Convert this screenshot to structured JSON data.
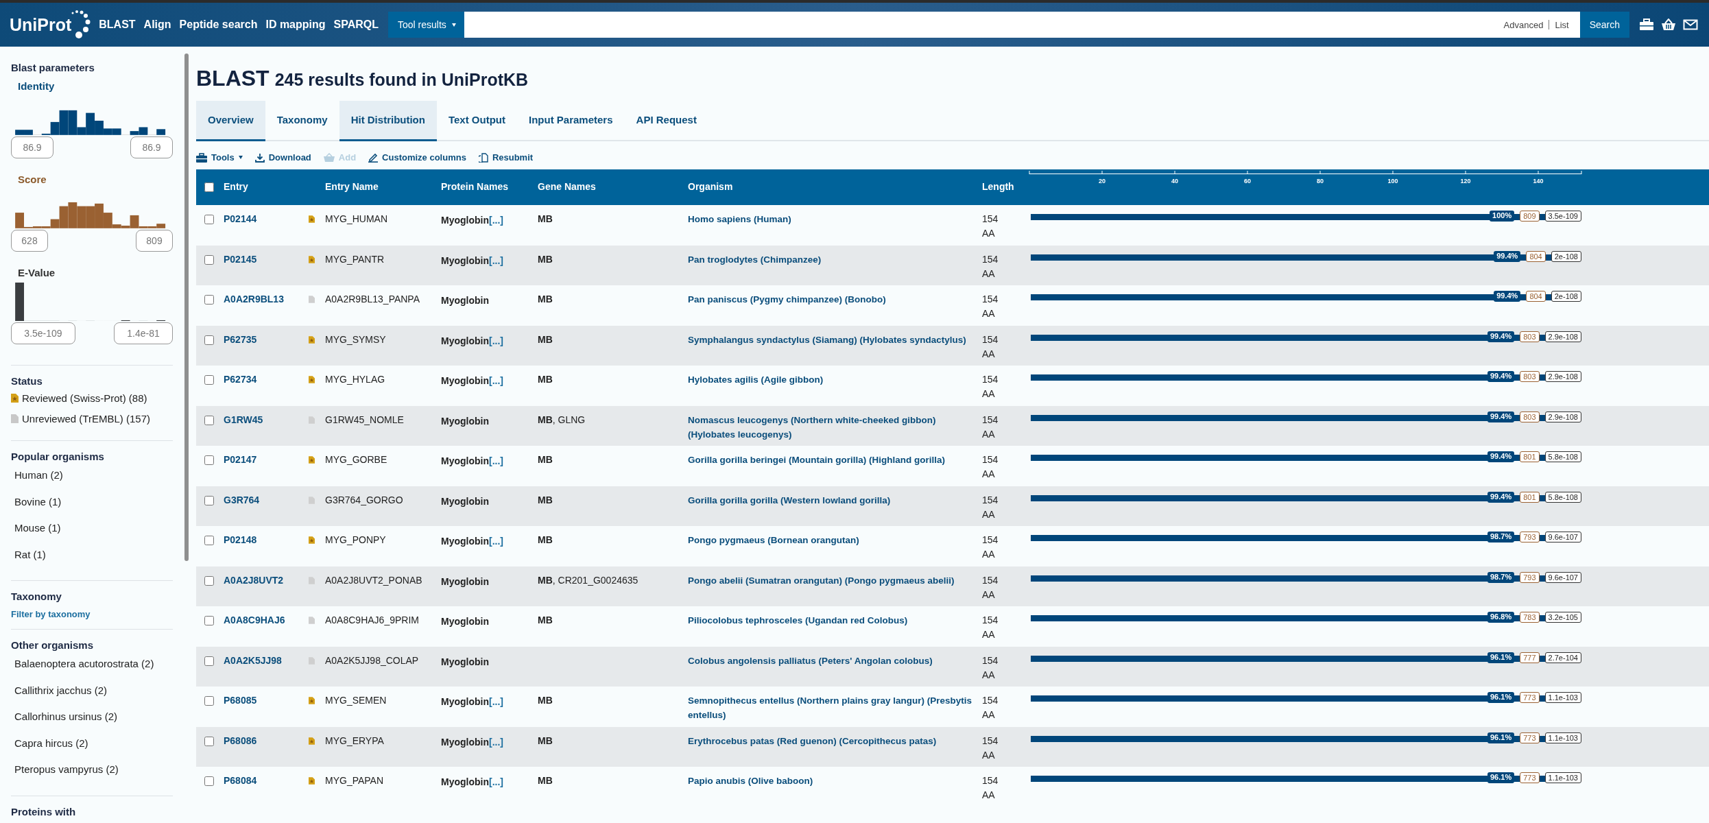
{
  "header": {
    "logo": "UniProt",
    "nav": [
      "BLAST",
      "Align",
      "Peptide search",
      "ID mapping",
      "SPARQL"
    ],
    "tool_menu": "Tool results",
    "search": {
      "links": [
        "Advanced",
        "List"
      ],
      "button": "Search"
    }
  },
  "sidebar": {
    "title": "Blast parameters",
    "ranges": [
      {
        "kind": "identity",
        "label": "Identity",
        "min": "86.9",
        "max": "86.9"
      },
      {
        "kind": "score",
        "label": "Score",
        "min": "628",
        "max": "809"
      },
      {
        "kind": "evalue",
        "label": "E-Value",
        "min": "3.5e-109",
        "max": "1.4e-81"
      }
    ],
    "status": {
      "title": "Status",
      "items": [
        {
          "label": "Reviewed (Swiss-Prot) (88)",
          "reviewed": true
        },
        {
          "label": "Unreviewed (TrEMBL) (157)",
          "reviewed": false
        }
      ]
    },
    "popular": {
      "title": "Popular organisms",
      "items": [
        "Human (2)",
        "Bovine (1)",
        "Mouse (1)",
        "Rat (1)"
      ]
    },
    "taxonomy": {
      "title": "Taxonomy",
      "link": "Filter by taxonomy"
    },
    "other": {
      "title": "Other organisms",
      "items": [
        "Balaenoptera acutorostrata (2)",
        "Callithrix jacchus (2)",
        "Callorhinus ursinus (2)",
        "Capra hircus (2)",
        "Pteropus vampyrus (2)"
      ]
    },
    "next_section": "Proteins with"
  },
  "main": {
    "title": "BLAST",
    "subtitle": "245 results found in UniProtKB",
    "tabs": [
      {
        "label": "Overview",
        "selected": true
      },
      {
        "label": "Taxonomy",
        "selected": false
      },
      {
        "label": "Hit Distribution",
        "selected": true
      },
      {
        "label": "Text Output",
        "selected": false
      },
      {
        "label": "Input Parameters",
        "selected": false
      },
      {
        "label": "API Request",
        "selected": false
      }
    ],
    "toolbar": [
      {
        "kind": "tools",
        "label": "Tools",
        "disabled": false
      },
      {
        "kind": "download",
        "label": "Download",
        "disabled": false
      },
      {
        "kind": "add",
        "label": "Add",
        "disabled": true
      },
      {
        "kind": "customize",
        "label": "Customize columns",
        "disabled": false
      },
      {
        "kind": "resubmit",
        "label": "Resubmit",
        "disabled": false
      }
    ]
  },
  "table": {
    "columns": [
      "Entry",
      "Entry Name",
      "Protein Names",
      "Gene Names",
      "Organism",
      "Length"
    ],
    "select_all_checked": false,
    "axis_ticks": [
      "20",
      "40",
      "60",
      "80",
      "100",
      "120",
      "140"
    ],
    "rows": [
      {
        "entry": "P02144",
        "reviewed": true,
        "entry_name": "MYG_HUMAN",
        "protein": "Myoglobin",
        "more": "[...]",
        "genes": "MB",
        "organism": "Homo sapiens (Human)",
        "length": "154 AA",
        "identity": "100%",
        "score": "809",
        "evalue": "3.5e-109",
        "checked": false
      },
      {
        "entry": "P02145",
        "reviewed": true,
        "entry_name": "MYG_PANTR",
        "protein": "Myoglobin",
        "more": "[...]",
        "genes": "MB",
        "organism": "Pan troglodytes (Chimpanzee)",
        "length": "154 AA",
        "identity": "99.4%",
        "score": "804",
        "evalue": "2e-108",
        "checked": false
      },
      {
        "entry": "A0A2R9BL13",
        "reviewed": false,
        "entry_name": "A0A2R9BL13_PANPA",
        "protein": "Myoglobin",
        "genes": "MB",
        "organism": "Pan paniscus (Pygmy chimpanzee) (Bonobo)",
        "length": "154 AA",
        "identity": "99.4%",
        "score": "804",
        "evalue": "2e-108",
        "checked": false
      },
      {
        "entry": "P62735",
        "reviewed": true,
        "entry_name": "MYG_SYMSY",
        "protein": "Myoglobin",
        "more": "[...]",
        "genes": "MB",
        "organism": "Symphalangus syndactylus (Siamang) (Hylobates syndactylus)",
        "length": "154 AA",
        "identity": "99.4%",
        "score": "803",
        "evalue": "2.9e-108",
        "checked": false
      },
      {
        "entry": "P62734",
        "reviewed": true,
        "entry_name": "MYG_HYLAG",
        "protein": "Myoglobin",
        "more": "[...]",
        "genes": "MB",
        "organism": "Hylobates agilis (Agile gibbon)",
        "length": "154 AA",
        "identity": "99.4%",
        "score": "803",
        "evalue": "2.9e-108",
        "checked": false
      },
      {
        "entry": "G1RW45",
        "reviewed": false,
        "entry_name": "G1RW45_NOMLE",
        "protein": "Myoglobin",
        "genes": "**MB**, GLNG",
        "organism": "Nomascus leucogenys (Northern white-cheeked gibbon) (Hylobates leucogenys)",
        "length": "154 AA",
        "identity": "99.4%",
        "score": "803",
        "evalue": "2.9e-108",
        "checked": false
      },
      {
        "entry": "P02147",
        "reviewed": true,
        "entry_name": "MYG_GORBE",
        "protein": "Myoglobin",
        "more": "[...]",
        "genes": "MB",
        "organism": "Gorilla gorilla beringei (Mountain gorilla) (Highland gorilla)",
        "length": "154 AA",
        "identity": "99.4%",
        "score": "801",
        "evalue": "5.8e-108",
        "checked": false
      },
      {
        "entry": "G3R764",
        "reviewed": false,
        "entry_name": "G3R764_GORGO",
        "protein": "Myoglobin",
        "genes": "MB",
        "organism": "Gorilla gorilla gorilla (Western lowland gorilla)",
        "length": "154 AA",
        "identity": "99.4%",
        "score": "801",
        "evalue": "5.8e-108",
        "checked": false
      },
      {
        "entry": "P02148",
        "reviewed": true,
        "entry_name": "MYG_PONPY",
        "protein": "Myoglobin",
        "more": "[...]",
        "genes": "MB",
        "organism": "Pongo pygmaeus (Bornean orangutan)",
        "length": "154 AA",
        "identity": "98.7%",
        "score": "793",
        "evalue": "9.6e-107",
        "checked": false
      },
      {
        "entry": "A0A2J8UVT2",
        "reviewed": false,
        "entry_name": "A0A2J8UVT2_PONAB",
        "protein": "Myoglobin",
        "genes": "**MB**, CR201_G0024635",
        "organism": "Pongo abelii (Sumatran orangutan) (Pongo pygmaeus abelii)",
        "length": "154 AA",
        "identity": "98.7%",
        "score": "793",
        "evalue": "9.6e-107",
        "checked": false
      },
      {
        "entry": "A0A8C9HAJ6",
        "reviewed": false,
        "entry_name": "A0A8C9HAJ6_9PRIM",
        "protein": "Myoglobin",
        "genes": "MB",
        "organism": "Piliocolobus tephrosceles (Ugandan red Colobus)",
        "length": "154 AA",
        "identity": "96.8%",
        "score": "783",
        "evalue": "3.2e-105",
        "checked": false
      },
      {
        "entry": "A0A2K5JJ98",
        "reviewed": false,
        "entry_name": "A0A2K5JJ98_COLAP",
        "protein": "Myoglobin",
        "organism": "Colobus angolensis palliatus (Peters' Angolan colobus)",
        "length": "154 AA",
        "identity": "96.1%",
        "score": "777",
        "evalue": "2.7e-104",
        "checked": false
      },
      {
        "entry": "P68085",
        "reviewed": true,
        "entry_name": "MYG_SEMEN",
        "protein": "Myoglobin",
        "more": "[...]",
        "genes": "MB",
        "organism": "Semnopithecus entellus (Northern plains gray langur) (Presbytis entellus)",
        "length": "154 AA",
        "identity": "96.1%",
        "score": "773",
        "evalue": "1.1e-103",
        "checked": false
      },
      {
        "entry": "P68086",
        "reviewed": true,
        "entry_name": "MYG_ERYPA",
        "protein": "Myoglobin",
        "more": "[...]",
        "genes": "MB",
        "organism": "Erythrocebus patas (Red guenon) (Cercopithecus patas)",
        "length": "154 AA",
        "identity": "96.1%",
        "score": "773",
        "evalue": "1.1e-103",
        "checked": false
      },
      {
        "entry": "P68084",
        "reviewed": true,
        "entry_name": "MYG_PAPAN",
        "protein": "Myoglobin",
        "more": "[...]",
        "genes": "MB",
        "organism": "Papio anubis (Olive baboon)",
        "length": "154 AA",
        "identity": "96.1%",
        "score": "773",
        "evalue": "1.1e-103",
        "checked": false
      }
    ]
  }
}
